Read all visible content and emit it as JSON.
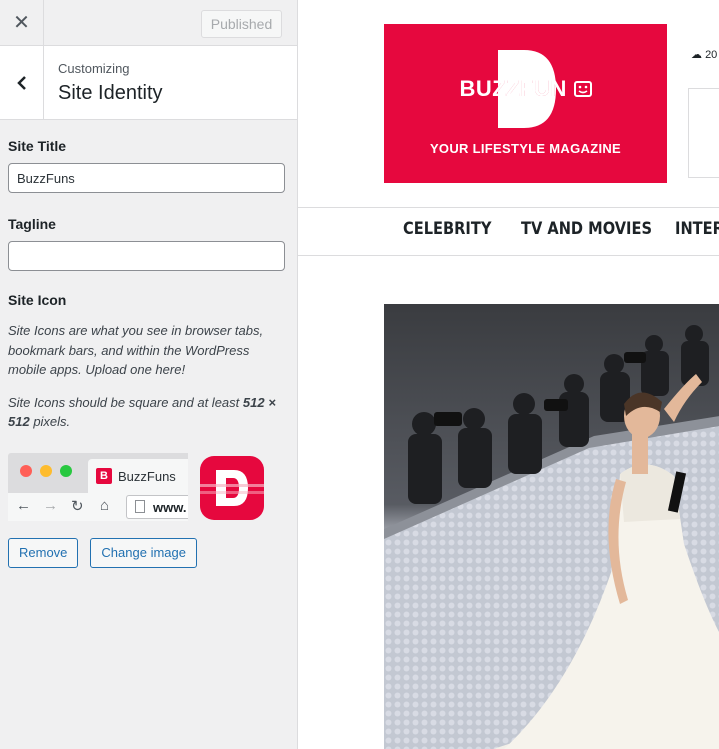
{
  "customizer": {
    "close_label": "✕",
    "publish_button": "Published",
    "breadcrumb": "Customizing",
    "section_title": "Site Identity",
    "site_title": {
      "label": "Site Title",
      "value": "BuzzFuns"
    },
    "tagline": {
      "label": "Tagline",
      "value": ""
    },
    "site_icon": {
      "label": "Site Icon",
      "description_1": "Site Icons are what you see in browser tabs, bookmark bars, and within the WordPress mobile apps. Upload one here!",
      "description_2_prefix": "Site Icons should be square and at least ",
      "description_2_bold": "512 × 512",
      "description_2_suffix": " pixels.",
      "browser_tab_title": "BuzzFuns",
      "browser_url": "www.",
      "remove_button": "Remove",
      "change_button": "Change image"
    }
  },
  "site": {
    "logo_word": "BUZZFUN",
    "logo_tagline": "YOUR LIFESTYLE MAGAZINE",
    "weather_text": "20",
    "menu": [
      "CELEBRITY",
      "TV AND MOVIES",
      "INTER"
    ]
  },
  "colors": {
    "brand": "#e6083e",
    "link": "#2271b1",
    "panel_bg": "#f0f0f1"
  }
}
